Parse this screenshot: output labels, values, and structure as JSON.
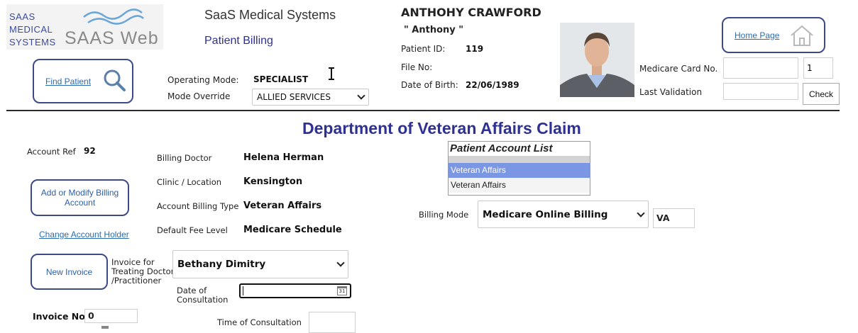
{
  "brand": {
    "logo_line1": "SAAS",
    "logo_line2": "MEDICAL",
    "logo_line3": "SYSTEMS",
    "logo_web": "SAAS Web",
    "company": "SaaS Medical Systems",
    "subtitle": "Patient Billing"
  },
  "find_patient": {
    "label": "Find Patient",
    "icon": "magnifier-icon"
  },
  "mode": {
    "operating_label": "Operating Mode:",
    "operating_value": "SPECIALIST",
    "override_label": "Mode Override",
    "override_value": "ALLIED SERVICES"
  },
  "patient": {
    "name": "ANTHOHY CRAWFORD",
    "nickname": "\" Anthony \"",
    "id_label": "Patient ID:",
    "id_value": "119",
    "file_label": "File No:",
    "dob_label": "Date of Birth:",
    "dob_value": "22/06/1989"
  },
  "medicare": {
    "card_label": "Medicare Card No.",
    "card_value": "",
    "irn_value": "1",
    "validation_label": "Last Validation",
    "validation_value": "",
    "check_label": "Check"
  },
  "home": {
    "label": "Home Page",
    "icon": "house-icon"
  },
  "page_title": "Department of Veteran Affairs Claim",
  "account": {
    "ref_label": "Account Ref",
    "ref_value": "92",
    "add_modify_label": "Add or Modify Billing Account",
    "change_holder_label": "Change Account Holder",
    "billing_doctor_label": "Billing Doctor",
    "billing_doctor_value": "Helena Herman",
    "clinic_label": "Clinic / Location",
    "clinic_value": "Kensington",
    "billing_type_label": "Account Billing Type",
    "billing_type_value": "Veteran Affairs",
    "fee_level_label": "Default Fee Level",
    "fee_level_value": "Medicare Schedule"
  },
  "account_list": {
    "title": "Patient Account List",
    "items": [
      "Veteran Affairs",
      "Veteran Affairs"
    ]
  },
  "billing_mode": {
    "label": "Billing Mode",
    "value": "Medicare Online Billing",
    "code": "VA"
  },
  "invoice": {
    "new_label": "New Invoice",
    "treating_label_1": "Invoice for",
    "treating_label_2": "Treating Doctor",
    "treating_label_3": "/Practitioner",
    "treating_value": "Bethany Dimitry",
    "date_label_1": "Date of",
    "date_label_2": "Consultation",
    "date_value": "",
    "calendar_text": "31",
    "number_label": "Invoice No.",
    "number_value": "0",
    "time_label": "Time of Consultation",
    "time_value": ""
  },
  "colors": {
    "accent": "#3d4a8a",
    "title": "#2e3192",
    "link": "#2b6cb0",
    "list_selected": "#7b96e3"
  }
}
